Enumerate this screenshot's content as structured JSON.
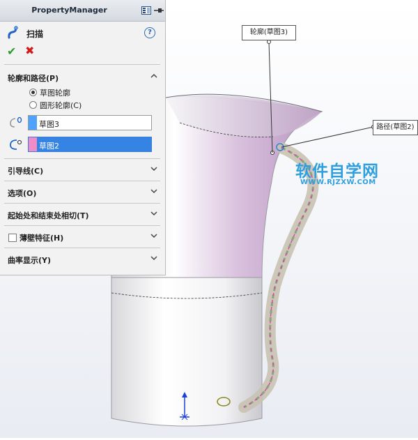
{
  "panel": {
    "title": "PropertyManager",
    "feature_name": "扫描",
    "help_label": "?"
  },
  "sections": {
    "profile_path": {
      "label": "轮廓和路径(P)",
      "radio_options": [
        {
          "label": "草图轮廓",
          "selected": true
        },
        {
          "label": "圆形轮廓(C)",
          "selected": false
        }
      ],
      "profile_field": {
        "value": "草图3",
        "color": "#4da3ff"
      },
      "path_field": {
        "value": "草图2",
        "color": "#f08cc8"
      }
    },
    "guide_curves": {
      "label": "引导线(C)"
    },
    "options": {
      "label": "选项(O)"
    },
    "tangency": {
      "label": "起始处和结束处相切(T)"
    },
    "thin_feature": {
      "label": "薄壁特征(H)",
      "checked": false
    },
    "curvature": {
      "label": "曲率显示(Y)"
    }
  },
  "callouts": {
    "profile": "轮廓(草图3)",
    "path": "路径(草图2)"
  },
  "watermark": {
    "title": "软件自学网",
    "url": "WWW.RJZXW.COM"
  },
  "colors": {
    "accent": "#3584e4",
    "ok": "#2a9b2a",
    "cancel": "#d21c1c",
    "cup_tint": "#c8a8d0"
  }
}
